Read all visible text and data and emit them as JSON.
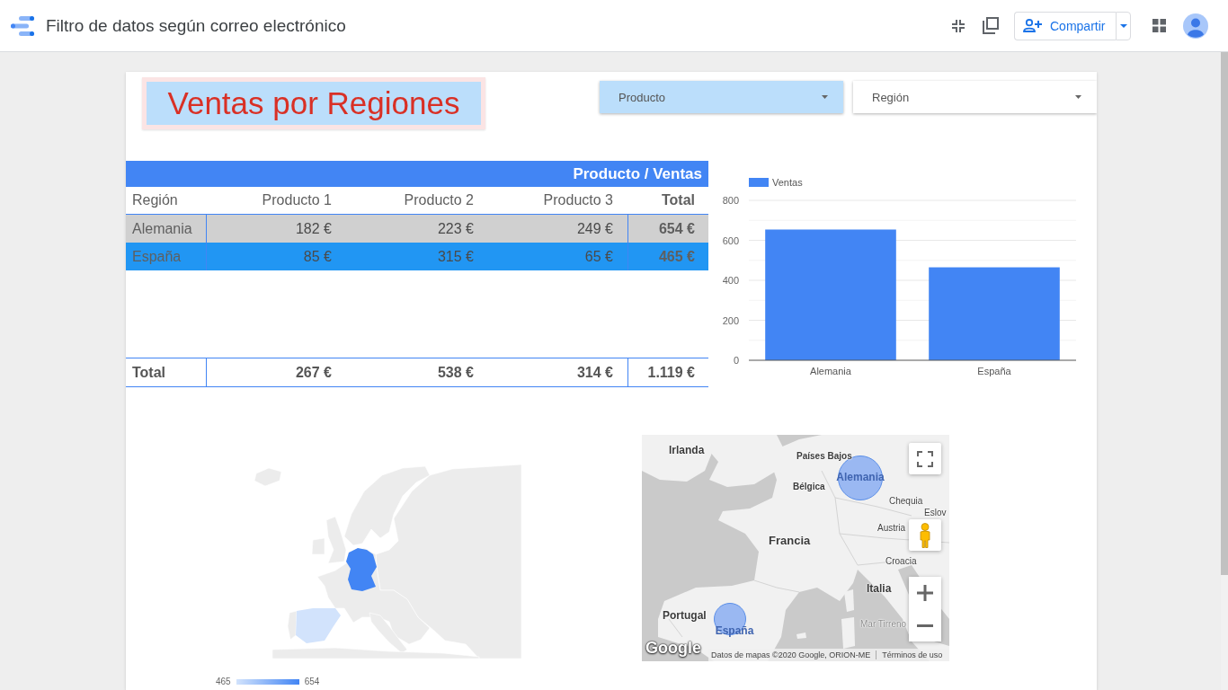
{
  "header": {
    "title": "Filtro de datos según correo electrónico",
    "share_button": "Compartir"
  },
  "report": {
    "title": "Ventas por Regiones",
    "filters": [
      {
        "label": "Producto",
        "selected": true
      },
      {
        "label": "Región",
        "selected": false
      }
    ],
    "table": {
      "title": "Producto / Ventas",
      "columns": [
        "Región",
        "Producto 1",
        "Producto 2",
        "Producto 3",
        "Total"
      ],
      "rows": [
        {
          "cells": [
            "Alemania",
            "182 €",
            "223 €",
            "249 €",
            "654 €"
          ],
          "color": "#d0d0d0"
        },
        {
          "cells": [
            "España",
            "85 €",
            "315 €",
            "65 €",
            "465 €"
          ],
          "color": "#2196f3"
        }
      ],
      "total": [
        "Total",
        "267 €",
        "538 €",
        "314 €",
        "1.119 €"
      ]
    },
    "bar_chart": {
      "chart_data": {
        "type": "bar",
        "categories": [
          "Alemania",
          "España"
        ],
        "series": [
          {
            "name": "Ventas",
            "color": "#4285f4",
            "values": [
              654,
              465
            ]
          }
        ],
        "ylim": [
          0,
          800
        ],
        "yticks": [
          0,
          200,
          400,
          600,
          800
        ],
        "grid": true
      }
    },
    "geo_chart": {
      "legend_min": "465",
      "legend_max": "654"
    },
    "bubble_map": {
      "places": [
        "Irlanda",
        "Países Bajos",
        "Bélgica",
        "Chequia",
        "Austria",
        "Eslov",
        "Francia",
        "Croacia",
        "Italia",
        "Portugal",
        "Mar Tirreno"
      ],
      "bubbles": [
        {
          "label": "Alemania"
        },
        {
          "label": "España"
        }
      ],
      "logo": "Google",
      "attribution": "Datos de mapas ©2020 Google, ORION-ME",
      "terms": "Términos de uso"
    }
  }
}
